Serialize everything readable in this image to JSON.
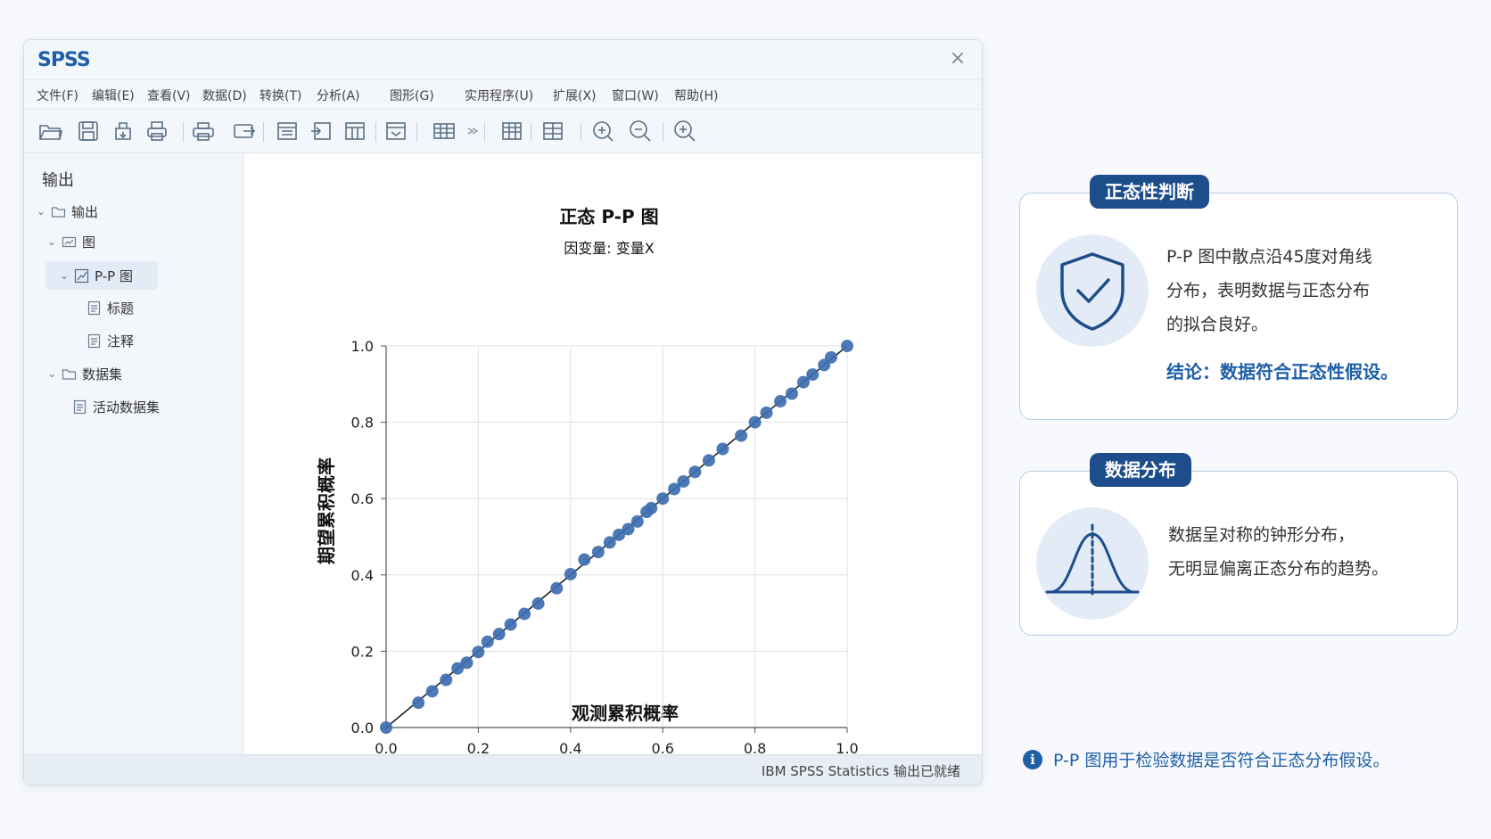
{
  "window": {
    "app_name": "SPSS",
    "close_glyph": "×",
    "menu": [
      "文件(F)",
      "编辑(E)",
      "查看(V)",
      "数据(D)",
      "转换(T)",
      "分析(A)",
      "图形(G)",
      "实用程序(U)",
      "扩展(X)",
      "窗口(W)",
      "帮助(H)"
    ],
    "toolbar_icons": [
      "open-folder-icon",
      "save-icon",
      "export-icon",
      "print-icon",
      "print-preview-icon",
      "export-output-icon",
      "goto-data-icon",
      "goto-case-icon",
      "goto-variable-icon",
      "variables-icon",
      "insert-table-icon",
      "insert-cases-icon",
      "split-file-icon",
      "select-cases-icon",
      "search-icon",
      "zoom-out-icon",
      "zoom-in-icon"
    ],
    "status": "IBM SPSS Statistics  输出已就绪"
  },
  "sidebar": {
    "title": "输出",
    "tree": {
      "root": "输出",
      "graph": "图",
      "pp": "P-P 图",
      "title_item": "标题",
      "notes_item": "注释",
      "dataset": "数据集",
      "active_dataset": "活动数据集"
    }
  },
  "chart_data": {
    "type": "scatter",
    "title": "正态 P-P 图",
    "subtitle": "因变量: 变量X",
    "xlabel": "观测累积概率",
    "ylabel": "期望累积概率",
    "xlim": [
      0.0,
      1.0
    ],
    "ylim": [
      0.0,
      1.0
    ],
    "xticks": [
      "0.0",
      "0.2",
      "0.4",
      "0.6",
      "0.8",
      "1.0"
    ],
    "yticks": [
      "0.0",
      "0.2",
      "0.4",
      "0.6",
      "0.8",
      "1.0"
    ],
    "grid": true,
    "reference_line": [
      [
        0,
        0
      ],
      [
        1,
        1
      ]
    ],
    "points": [
      [
        0.0,
        0.0
      ],
      [
        0.07,
        0.065
      ],
      [
        0.1,
        0.095
      ],
      [
        0.13,
        0.125
      ],
      [
        0.155,
        0.155
      ],
      [
        0.175,
        0.17
      ],
      [
        0.2,
        0.198
      ],
      [
        0.22,
        0.225
      ],
      [
        0.245,
        0.245
      ],
      [
        0.27,
        0.27
      ],
      [
        0.3,
        0.298
      ],
      [
        0.33,
        0.325
      ],
      [
        0.37,
        0.365
      ],
      [
        0.4,
        0.402
      ],
      [
        0.43,
        0.44
      ],
      [
        0.46,
        0.46
      ],
      [
        0.485,
        0.485
      ],
      [
        0.505,
        0.505
      ],
      [
        0.525,
        0.52
      ],
      [
        0.545,
        0.54
      ],
      [
        0.565,
        0.565
      ],
      [
        0.575,
        0.575
      ],
      [
        0.6,
        0.6
      ],
      [
        0.625,
        0.625
      ],
      [
        0.645,
        0.645
      ],
      [
        0.67,
        0.67
      ],
      [
        0.7,
        0.7
      ],
      [
        0.73,
        0.73
      ],
      [
        0.77,
        0.765
      ],
      [
        0.8,
        0.8
      ],
      [
        0.825,
        0.825
      ],
      [
        0.855,
        0.855
      ],
      [
        0.88,
        0.875
      ],
      [
        0.905,
        0.905
      ],
      [
        0.925,
        0.925
      ],
      [
        0.95,
        0.95
      ],
      [
        0.965,
        0.97
      ],
      [
        1.0,
        1.0
      ]
    ],
    "point_color": "#3e6fb0",
    "line_color": "#222222"
  },
  "panels": {
    "normality": {
      "tag": "正态性判断",
      "icon": "shield-check-icon",
      "lines": [
        "P-P 图中散点沿45度对角线",
        "分布，表明数据与正态分布",
        "的拟合良好。"
      ],
      "conclusion": "结论：数据符合正态性假设。"
    },
    "distribution": {
      "tag": "数据分布",
      "icon": "bell-curve-icon",
      "lines": [
        "数据呈对称的钟形分布，",
        "无明显偏离正态分布的趋势。"
      ]
    },
    "note": "P-P 图用于检验数据是否符合正态分布假设。"
  },
  "colors": {
    "accent": "#1e5fa8",
    "tag_bg": "#1e4d8c",
    "card_border": "#b9cde4"
  }
}
